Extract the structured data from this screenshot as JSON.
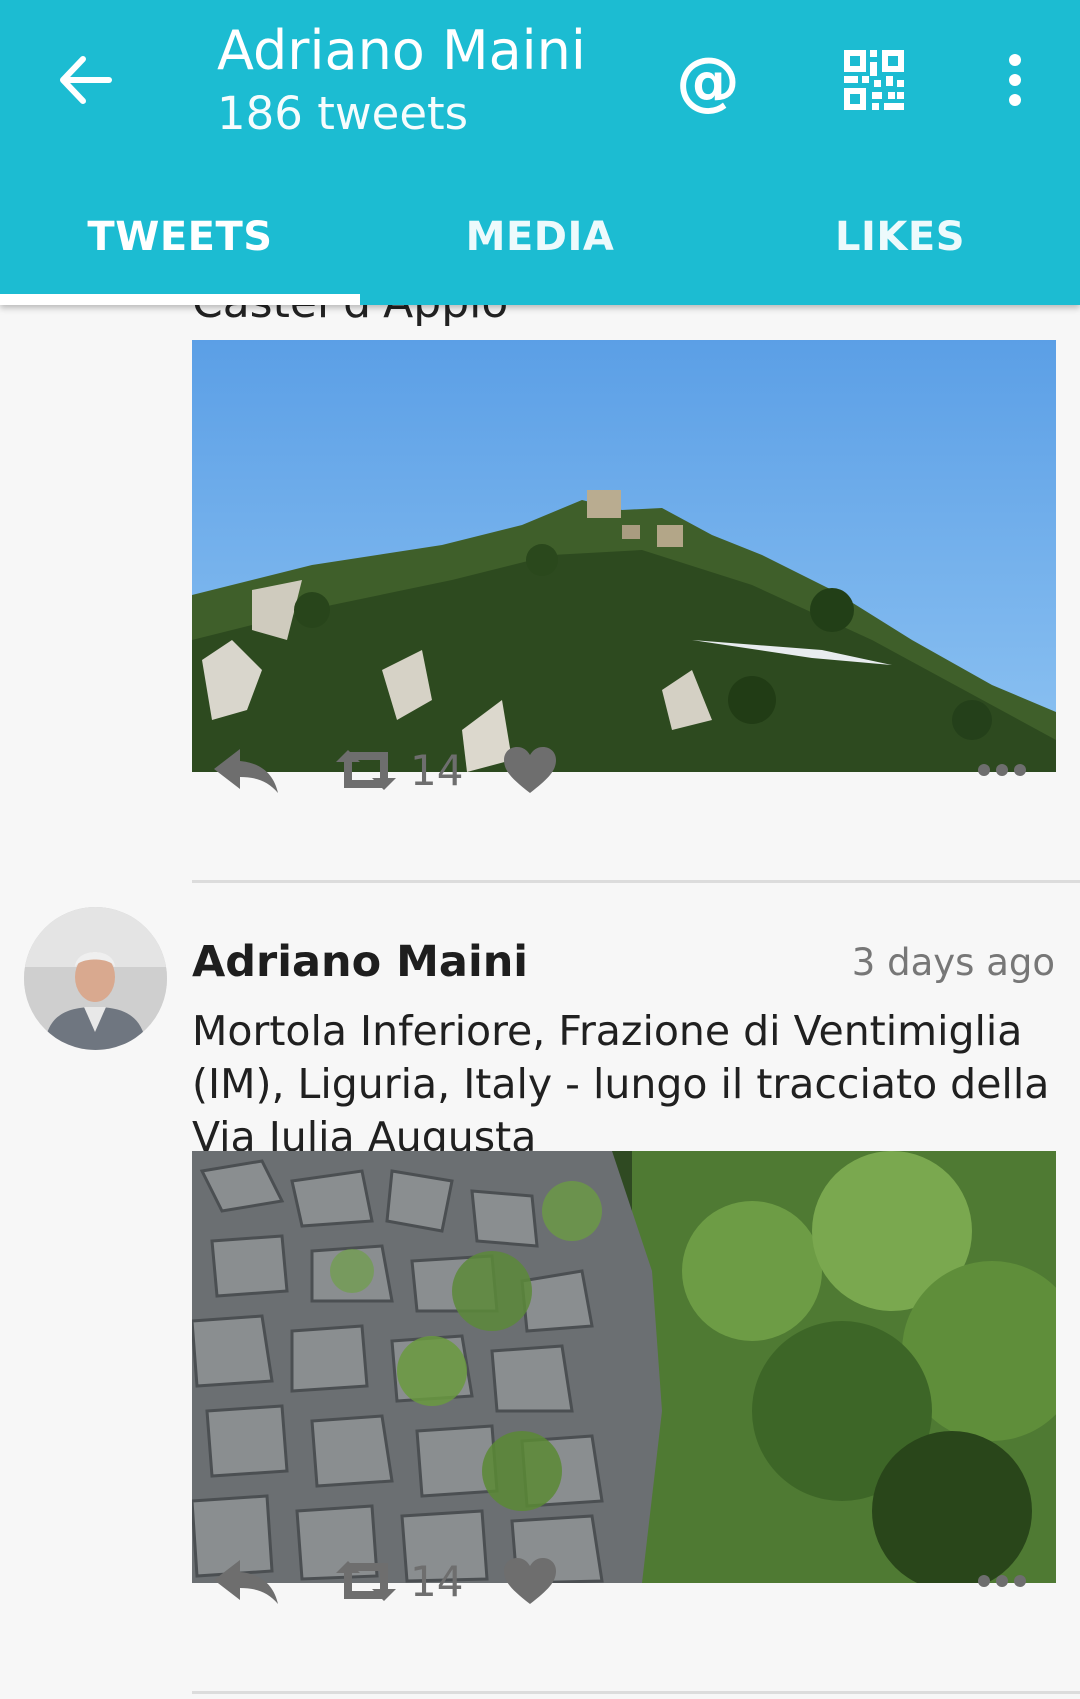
{
  "header": {
    "title": "Adriano Maini",
    "subtitle": "186 tweets",
    "mention_icon": "@",
    "accent_color": "#1cbcd2"
  },
  "tabs": [
    {
      "label": "TWEETS",
      "selected": true
    },
    {
      "label": "MEDIA",
      "selected": false
    },
    {
      "label": "LIKES",
      "selected": false
    }
  ],
  "tweets": [
    {
      "text": "Castel d'Appio",
      "image": "hill-with-castle-ruins",
      "retweet_count": "14"
    },
    {
      "author": "Adriano Maini",
      "time": "3 days ago",
      "text": "Mortola Inferiore, Frazione di Ventimiglia (IM), Liguria, Italy - lungo il tracciato della Via Iulia Augusta",
      "image": "dry-stone-wall-with-vegetation",
      "retweet_count": "14"
    }
  ],
  "icons": [
    "back-arrow-icon",
    "at-icon",
    "qr-code-icon",
    "more-vert-icon",
    "reply-icon",
    "retweet-icon",
    "heart-icon",
    "more-horiz-icon"
  ]
}
